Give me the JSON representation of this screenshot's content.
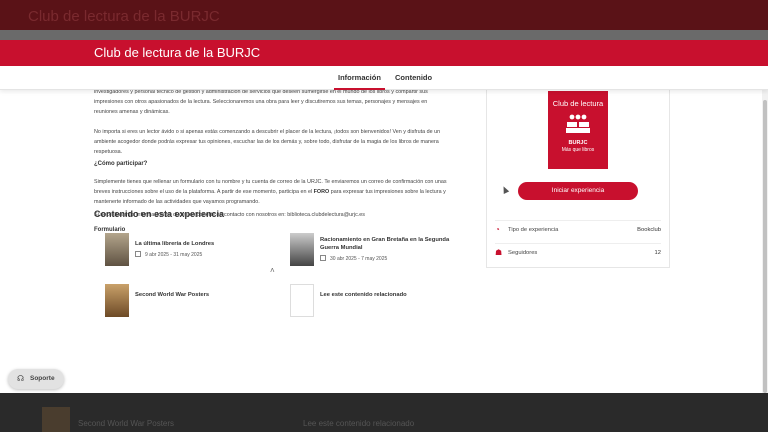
{
  "background": {
    "header_title": "Club de lectura de la BURJC",
    "items": [
      "Second World War Posters",
      "Lee este contenido relacionado"
    ]
  },
  "header": {
    "title": "Club de lectura de la BURJC"
  },
  "tabs": [
    {
      "label": "Información",
      "active": true
    },
    {
      "label": "Contenido",
      "active": false
    }
  ],
  "info": {
    "p1": "investigadores y personal técnico de gestión y administración de servicios que deseen sumergirse en el mundo de los libros y compartir sus impresiones con otros apasionados de la lectura. Seleccionaremos una obra para leer y discutiremos sus temas, personajes y mensajes en reuniones amenas y dinámicas.",
    "p2": "No importa si eres un lector ávido o si apenas estás comenzando a descubrir el placer de la lectura, ¡todos son bienvenidos! Ven y disfruta de un ambiente acogedor donde podrás expresar tus opiniones, escuchar las de los demás y, sobre todo, disfrutar de la magia de los libros de manera respetuosa.",
    "how_heading": "¿Cómo participar?",
    "p3_before": "Simplemente tienes que rellenar un formulario con tu nombre y tu cuenta de correo de la URJC. Te enviaremos un correo de confirmación con unas breves instrucciones sobre el uso de la plataforma.  A partir de ese momento, participa en el ",
    "p3_foro": "FORO",
    "p3_after": " para expresar tus impresiones sobre la lectura y mantenerte informado de las actividades que vayamos programando.",
    "p4": "Si necesitas más información no dudes en ponerte en contacto con nosotros en: biblioteca.clubdelectura@urjc.es",
    "form_label": "Formulario",
    "collapse_icon": "chevron-up-icon"
  },
  "card": {
    "cover_title": "Club de lectura",
    "cover_brand": "BURJC",
    "cover_subtitle": "Más que libros",
    "start_button": "Iniciar experiencia",
    "rows": [
      {
        "icon": "experience-type-icon",
        "label": "Tipo de experiencia",
        "value": "Bookclub"
      },
      {
        "icon": "followers-icon",
        "label": "Seguidores",
        "value": "12"
      }
    ]
  },
  "related": {
    "title": "Contenido en esta experiencia",
    "items": [
      {
        "name": "La última librería de Londres",
        "date": "9 abr 2025 - 31 may 2025"
      },
      {
        "name": "Racionamiento en Gran Bretaña en la Segunda Guerra Mundial",
        "date": "30 abr 2025 - 7 may 2025"
      },
      {
        "name": "Second World War Posters",
        "date": ""
      },
      {
        "name": "Lee este contenido relacionado",
        "date": ""
      }
    ]
  },
  "support": {
    "label": "Soporte",
    "icon": "headset-icon"
  },
  "colors": {
    "brand_red": "#c8102e",
    "overlay_dark": "#2a2a2a"
  }
}
